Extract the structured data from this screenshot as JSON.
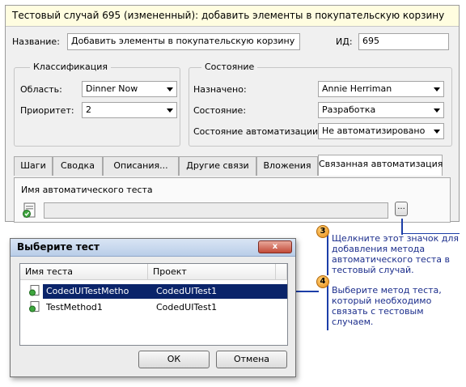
{
  "test_case": {
    "title": "Тестовый случай 695 (измененный): добавить элементы в покупательскую корзину",
    "name_label": "Название:",
    "name_value": "Добавить элементы в покупательскую корзину",
    "id_label": "ИД:",
    "id_value": "695",
    "classification": {
      "title": "Классификация",
      "area_label": "Область:",
      "area_value": "Dinner Now",
      "priority_label": "Приоритет:",
      "priority_value": "2"
    },
    "status": {
      "title": "Состояние",
      "assigned_label": "Назначено:",
      "assigned_value": "Annie Herriman",
      "state_label": "Состояние:",
      "state_value": "Разработка",
      "automation_label": "Состояние автоматизации:",
      "automation_value": "Не автоматизировано"
    },
    "tabs": [
      {
        "label": "Шаги"
      },
      {
        "label": "Сводка"
      },
      {
        "label": "Описания..."
      },
      {
        "label": "Другие связи"
      },
      {
        "label": "Вложения"
      },
      {
        "label": "Связанная автоматизация"
      }
    ],
    "active_tab": "Связанная автоматизация",
    "auto_test_label": "Имя автоматического теста",
    "auto_test_value": "",
    "browse_button_label": "..."
  },
  "dialog": {
    "title": "Выберите тест",
    "close_label": "x",
    "columns": [
      "Имя теста",
      "Проект"
    ],
    "rows": [
      {
        "name": "CodedUITestMetho",
        "project": "CodedUITest1",
        "selected": true
      },
      {
        "name": "TestMethod1",
        "project": "CodedUITest1",
        "selected": false
      }
    ],
    "ok_label": "ОК",
    "cancel_label": "Отмена"
  },
  "callouts": [
    {
      "number": "3",
      "text": "Щелкните этот значок для добавления метода автоматического теста в тестовый случай."
    },
    {
      "number": "4",
      "text": "Выберите метод теста, который необходимо связать с тестовым случаем."
    }
  ],
  "colors": {
    "selection": "#0a246a",
    "callout_text": "#1c2e8c",
    "callout_badge": "#e98a12",
    "title_bar": "#fffde0"
  }
}
